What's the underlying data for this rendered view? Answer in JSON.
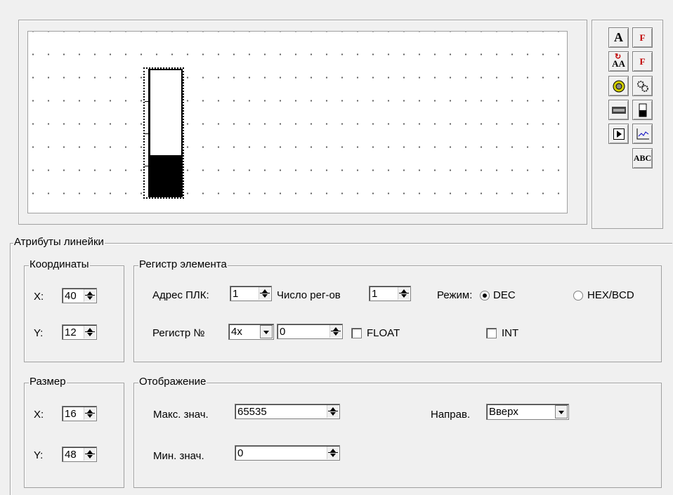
{
  "toolbox": {
    "text_tool": "A",
    "formula_tool": "F",
    "lang_text_tool": "AA",
    "lang_formula_tool": "F",
    "abc_tool": "ABC"
  },
  "preview": {
    "bar_fill_fraction": 0.33
  },
  "ruler_attrs": {
    "title": "Атрибуты линейки",
    "coords": {
      "title": "Координаты",
      "x_label": "X:",
      "x_value": "40",
      "y_label": "Y:",
      "y_value": "12"
    },
    "size": {
      "title": "Размер",
      "x_label": "X:",
      "x_value": "16",
      "y_label": "Y:",
      "y_value": "48"
    },
    "register": {
      "title": "Регистр элемента",
      "plc_addr_label": "Адрес ПЛК:",
      "plc_addr_value": "1",
      "reg_count_label": "Число рег-ов",
      "reg_count_value": "1",
      "mode_label": "Режим:",
      "mode_dec": "DEC",
      "mode_hex": "HEX/BCD",
      "reg_num_label": "Регистр №",
      "reg_type_value": "4x",
      "reg_num_value": "0",
      "float_label": "FLOAT",
      "int_label": "INT"
    },
    "display": {
      "title": "Отображение",
      "max_label": "Макс. знач.",
      "max_value": "65535",
      "min_label": "Мин. знач.",
      "min_value": "0",
      "dir_label": "Направ.",
      "dir_value": "Вверх"
    }
  }
}
